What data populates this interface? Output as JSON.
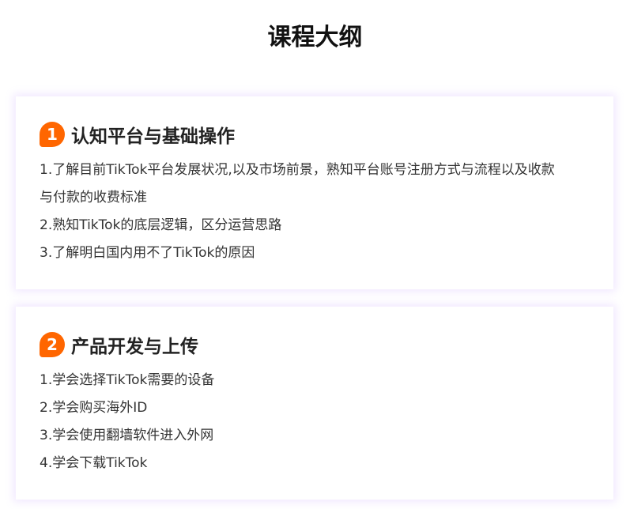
{
  "page_title": "课程大纲",
  "sections": [
    {
      "number": "1",
      "title": "认知平台与基础操作",
      "items": [
        "1.了解目前TikTok平台发展状况,以及市场前景，熟知平台账号注册方式与流程以及收款",
        "与付款的收费标准",
        "2.熟知TikTok的底层逻辑，区分运营思路",
        "3.了解明白国内用不了TikTok的原因"
      ]
    },
    {
      "number": "2",
      "title": "产品开发与上传",
      "items": [
        "1.学会选择TikTok需要的设备",
        "2.学会购买海外ID",
        "3.学会使用翻墙软件进入外网",
        "4.学会下载TikTok"
      ]
    }
  ],
  "colors": {
    "accent": "#ff6600",
    "card_shadow": "#be96ff"
  }
}
